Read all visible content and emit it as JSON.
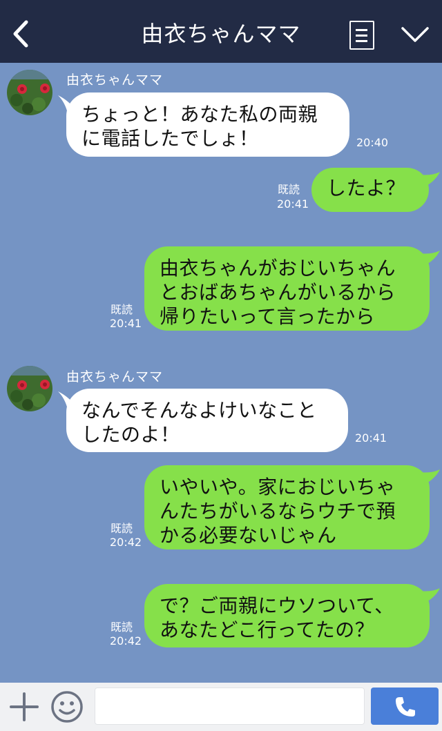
{
  "header": {
    "title": "由衣ちゃんママ",
    "back_icon": "chevron-left-icon",
    "menu_icon": "notes-icon",
    "expand_icon": "chevron-down-icon"
  },
  "colors": {
    "header_bg": "#222b45",
    "chat_bg": "#7594c4",
    "bubble_in": "#ffffff",
    "bubble_out": "#86e04a",
    "send_button": "#4a7fd9"
  },
  "messages": [
    {
      "direction": "in",
      "sender": "由衣ちゃんママ",
      "text": "ちょっと！あなた私の両親\nに電話したでしょ！",
      "time": "20:40"
    },
    {
      "direction": "out",
      "read": "既読",
      "text": "したよ？",
      "time": "20:41"
    },
    {
      "direction": "out",
      "read": "既読",
      "text": "由衣ちゃんがおじいちゃん\nとおばあちゃんがいるから\n帰りたいって言ったから",
      "time": "20:41"
    },
    {
      "direction": "in",
      "sender": "由衣ちゃんママ",
      "text": "なんでそんなよけいなこと\nしたのよ！",
      "time": "20:41"
    },
    {
      "direction": "out",
      "read": "既読",
      "text": "いやいや。家におじいちゃ\nんたちがいるならウチで預\nかる必要ないじゃん",
      "time": "20:42"
    },
    {
      "direction": "out",
      "read": "既読",
      "text": "で？ご両親にウソついて、\nあなたどこ行ってたの？",
      "time": "20:42"
    }
  ],
  "footer": {
    "plus_icon": "plus-icon",
    "emoji_icon": "smiley-icon",
    "input_value": "",
    "send_icon": "phone-icon"
  }
}
